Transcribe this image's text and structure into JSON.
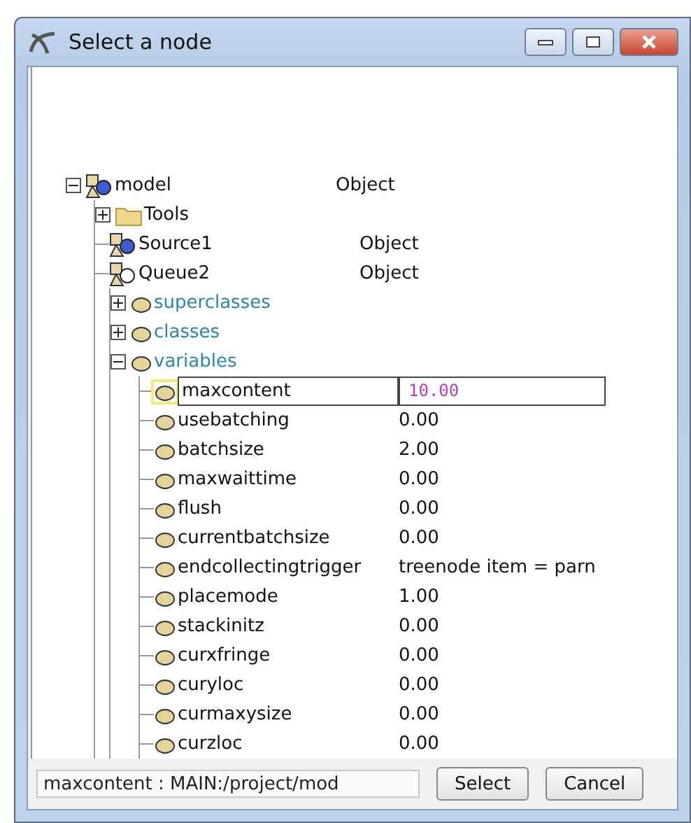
{
  "window": {
    "title": "Select a node"
  },
  "tree": [
    {
      "kind": "object",
      "label": "model",
      "value": "Object",
      "color": "#3a5fcd",
      "expanded": true,
      "children": [
        {
          "kind": "folder",
          "label": "Tools",
          "expanded": false
        },
        {
          "kind": "object",
          "label": "Source1",
          "value": "Object",
          "color": "#3a5fcd"
        },
        {
          "kind": "object",
          "label": "Queue2",
          "value": "Object",
          "color": "#ffffff",
          "children": [
            {
              "kind": "group",
              "label": "superclasses",
              "expanded": false
            },
            {
              "kind": "group",
              "label": "classes",
              "expanded": false
            },
            {
              "kind": "group",
              "label": "variables",
              "expanded": true,
              "children": [
                {
                  "kind": "attribute",
                  "label": "maxcontent",
                  "value": "10.00",
                  "selected": true
                },
                {
                  "kind": "attribute",
                  "label": "usebatching",
                  "value": "0.00",
                  "selected": false
                },
                {
                  "kind": "attribute",
                  "label": "batchsize",
                  "value": "2.00",
                  "selected": false
                },
                {
                  "kind": "attribute",
                  "label": "maxwaittime",
                  "value": "0.00",
                  "selected": false
                },
                {
                  "kind": "attribute",
                  "label": "flush",
                  "value": "0.00",
                  "selected": false
                },
                {
                  "kind": "attribute",
                  "label": "currentbatchsize",
                  "value": "0.00",
                  "selected": false
                },
                {
                  "kind": "attribute",
                  "label": "endcollectingtrigger",
                  "value": "treenode  item = parn",
                  "selected": false
                },
                {
                  "kind": "attribute",
                  "label": "placemode",
                  "value": "1.00",
                  "selected": false
                },
                {
                  "kind": "attribute",
                  "label": "stackinitz",
                  "value": "0.00",
                  "selected": false
                },
                {
                  "kind": "attribute",
                  "label": "curxfringe",
                  "value": "0.00",
                  "selected": false
                },
                {
                  "kind": "attribute",
                  "label": "curyloc",
                  "value": "0.00",
                  "selected": false
                },
                {
                  "kind": "attribute",
                  "label": "curmaxysize",
                  "value": "0.00",
                  "selected": false
                },
                {
                  "kind": "attribute",
                  "label": "curzloc",
                  "value": "0.00",
                  "selected": false
                }
              ]
            }
          ]
        }
      ]
    }
  ],
  "footer": {
    "path": "maxcontent : MAIN:/project/mod",
    "buttons": [
      "Select",
      "Cancel"
    ]
  }
}
